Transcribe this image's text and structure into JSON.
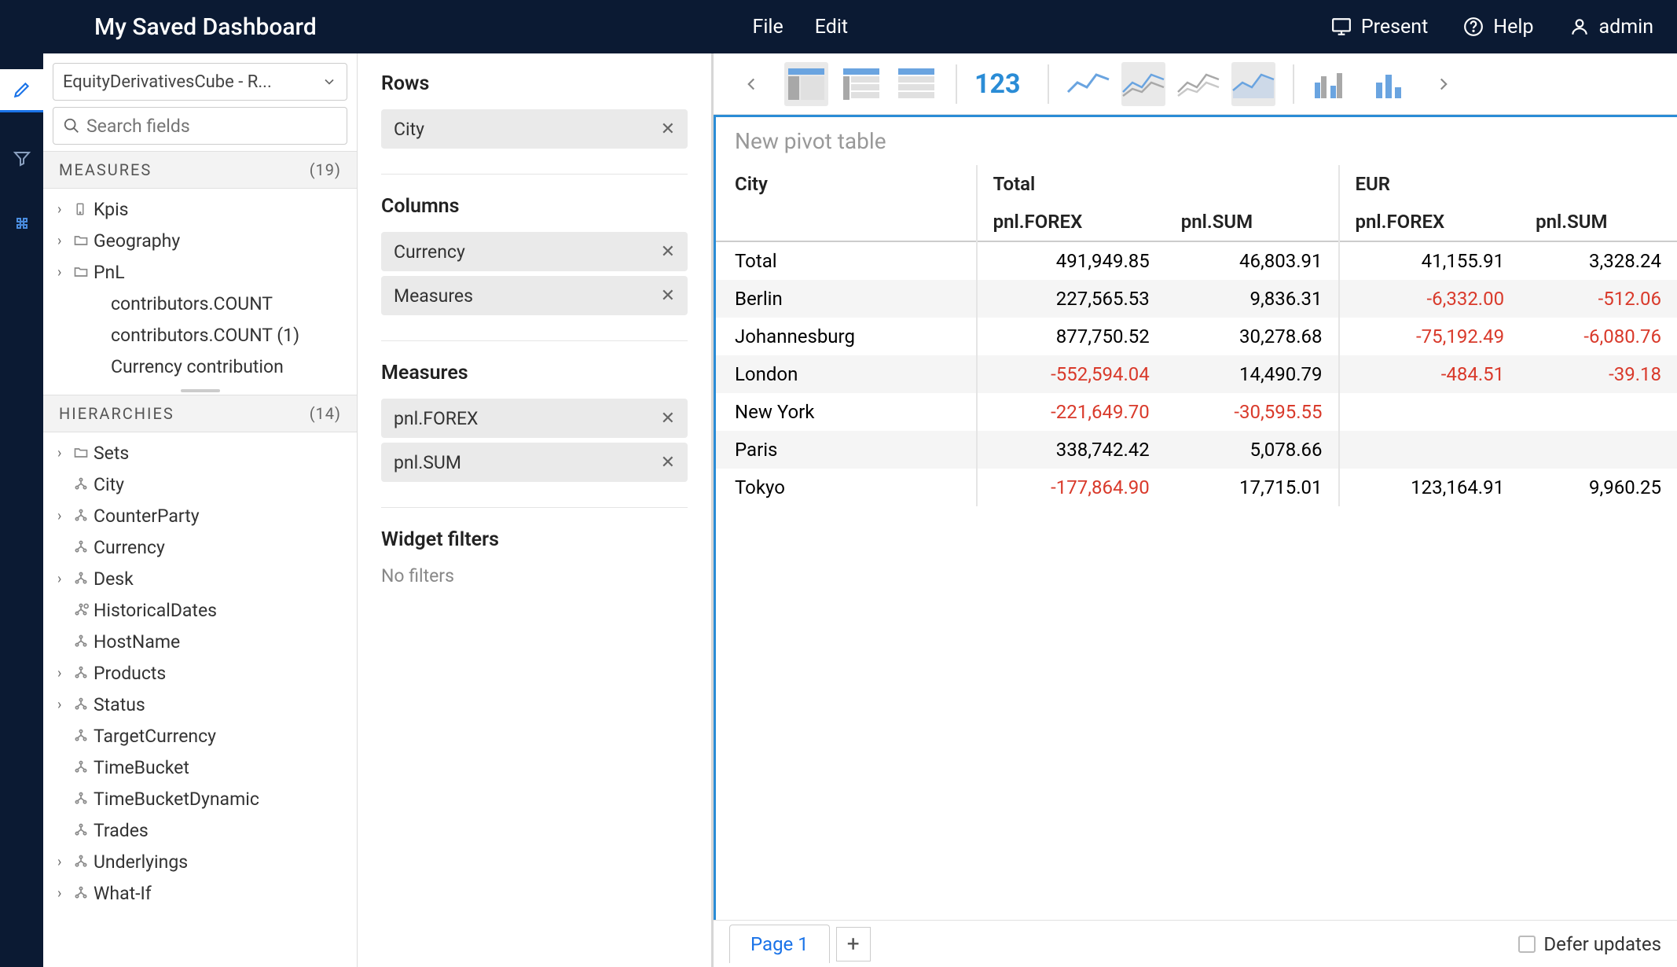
{
  "header": {
    "title": "My Saved Dashboard",
    "menu": {
      "file": "File",
      "edit": "Edit"
    },
    "present": "Present",
    "help": "Help",
    "user": "admin"
  },
  "cube_select": "EquityDerivativesCube - R...",
  "search_placeholder": "Search fields",
  "measures": {
    "label": "MEASURES",
    "count": "(19)",
    "items": [
      {
        "label": "Kpis",
        "expandable": true,
        "icon": "device"
      },
      {
        "label": "Geography",
        "expandable": true,
        "icon": "folder"
      },
      {
        "label": "PnL",
        "expandable": true,
        "icon": "folder"
      },
      {
        "label": "contributors.COUNT",
        "expandable": false
      },
      {
        "label": "contributors.COUNT (1)",
        "expandable": false
      },
      {
        "label": "Currency contribution",
        "expandable": false
      }
    ]
  },
  "hierarchies": {
    "label": "HIERARCHIES",
    "count": "(14)",
    "items": [
      {
        "label": "Sets",
        "expandable": true,
        "icon": "folder"
      },
      {
        "label": "City",
        "expandable": false,
        "icon": "hier"
      },
      {
        "label": "CounterParty",
        "expandable": true,
        "icon": "hier"
      },
      {
        "label": "Currency",
        "expandable": false,
        "icon": "hier"
      },
      {
        "label": "Desk",
        "expandable": true,
        "icon": "hier"
      },
      {
        "label": "HistoricalDates",
        "expandable": false,
        "icon": "hier-date"
      },
      {
        "label": "HostName",
        "expandable": false,
        "icon": "hier"
      },
      {
        "label": "Products",
        "expandable": true,
        "icon": "hier"
      },
      {
        "label": "Status",
        "expandable": true,
        "icon": "hier"
      },
      {
        "label": "TargetCurrency",
        "expandable": false,
        "icon": "hier"
      },
      {
        "label": "TimeBucket",
        "expandable": false,
        "icon": "hier"
      },
      {
        "label": "TimeBucketDynamic",
        "expandable": false,
        "icon": "hier"
      },
      {
        "label": "Trades",
        "expandable": false,
        "icon": "hier"
      },
      {
        "label": "Underlyings",
        "expandable": true,
        "icon": "hier"
      },
      {
        "label": "What-If",
        "expandable": true,
        "icon": "hier"
      }
    ]
  },
  "config": {
    "rows_label": "Rows",
    "rows": [
      "City"
    ],
    "columns_label": "Columns",
    "columns": [
      "Currency",
      "Measures"
    ],
    "measures_label": "Measures",
    "measures": [
      "pnl.FOREX",
      "pnl.SUM"
    ],
    "filters_label": "Widget filters",
    "no_filters": "No filters"
  },
  "toolbar": {
    "number_label": "123"
  },
  "pivot": {
    "title": "New pivot table",
    "row_header": "City",
    "col_groups": [
      "Total",
      "EUR"
    ],
    "sub_cols": [
      "pnl.FOREX",
      "pnl.SUM",
      "pnl.FOREX",
      "pnl.SUM"
    ],
    "rows": [
      {
        "city": "Total",
        "vals": [
          "491,949.85",
          "46,803.91",
          "41,155.91",
          "3,328.24"
        ],
        "neg": [
          false,
          false,
          false,
          false
        ]
      },
      {
        "city": "Berlin",
        "vals": [
          "227,565.53",
          "9,836.31",
          "-6,332.00",
          "-512.06"
        ],
        "neg": [
          false,
          false,
          true,
          true
        ]
      },
      {
        "city": "Johannesburg",
        "vals": [
          "877,750.52",
          "30,278.68",
          "-75,192.49",
          "-6,080.76"
        ],
        "neg": [
          false,
          false,
          true,
          true
        ]
      },
      {
        "city": "London",
        "vals": [
          "-552,594.04",
          "14,490.79",
          "-484.51",
          "-39.18"
        ],
        "neg": [
          true,
          false,
          true,
          true
        ]
      },
      {
        "city": "New York",
        "vals": [
          "-221,649.70",
          "-30,595.55",
          "",
          ""
        ],
        "neg": [
          true,
          true,
          false,
          false
        ]
      },
      {
        "city": "Paris",
        "vals": [
          "338,742.42",
          "5,078.66",
          "",
          ""
        ],
        "neg": [
          false,
          false,
          false,
          false
        ]
      },
      {
        "city": "Tokyo",
        "vals": [
          "-177,864.90",
          "17,715.01",
          "123,164.91",
          "9,960.25"
        ],
        "neg": [
          true,
          false,
          false,
          false
        ]
      }
    ]
  },
  "footer": {
    "page": "Page 1",
    "add": "+",
    "defer": "Defer updates"
  }
}
